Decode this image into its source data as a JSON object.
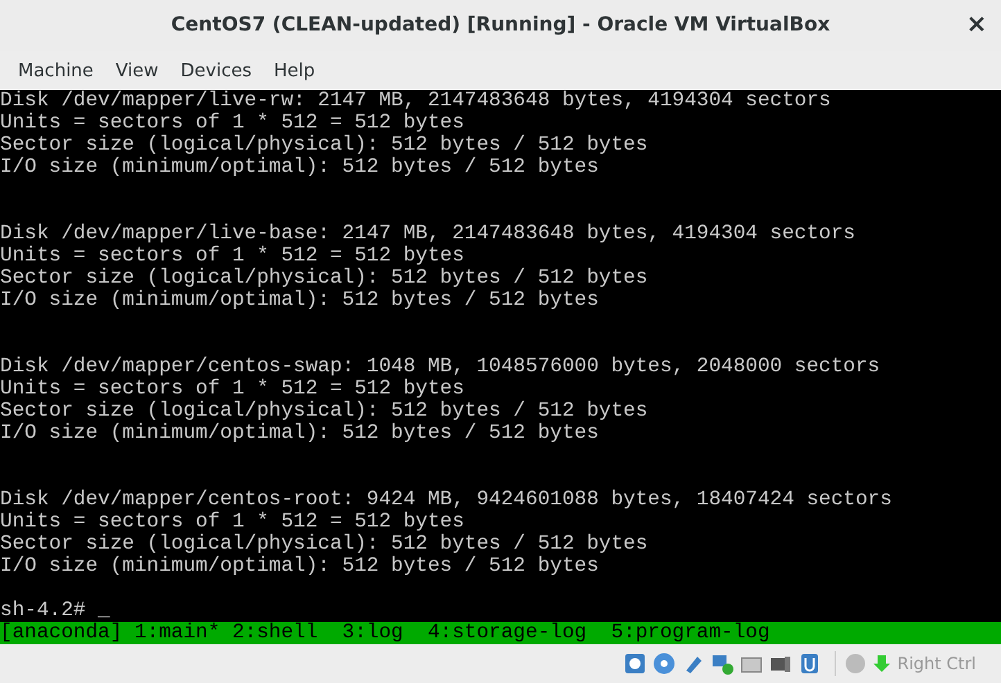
{
  "window": {
    "title": "CentOS7 (CLEAN-updated) [Running] - Oracle VM VirtualBox",
    "close": "×"
  },
  "menu": [
    "Machine",
    "View",
    "Devices",
    "Help"
  ],
  "terminal": {
    "blocks": [
      [
        "Disk /dev/mapper/live-rw: 2147 MB, 2147483648 bytes, 4194304 sectors",
        "Units = sectors of 1 * 512 = 512 bytes",
        "Sector size (logical/physical): 512 bytes / 512 bytes",
        "I/O size (minimum/optimal): 512 bytes / 512 bytes"
      ],
      [
        "Disk /dev/mapper/live-base: 2147 MB, 2147483648 bytes, 4194304 sectors",
        "Units = sectors of 1 * 512 = 512 bytes",
        "Sector size (logical/physical): 512 bytes / 512 bytes",
        "I/O size (minimum/optimal): 512 bytes / 512 bytes"
      ],
      [
        "Disk /dev/mapper/centos-swap: 1048 MB, 1048576000 bytes, 2048000 sectors",
        "Units = sectors of 1 * 512 = 512 bytes",
        "Sector size (logical/physical): 512 bytes / 512 bytes",
        "I/O size (minimum/optimal): 512 bytes / 512 bytes"
      ],
      [
        "Disk /dev/mapper/centos-root: 9424 MB, 9424601088 bytes, 18407424 sectors",
        "Units = sectors of 1 * 512 = 512 bytes",
        "Sector size (logical/physical): 512 bytes / 512 bytes",
        "I/O size (minimum/optimal): 512 bytes / 512 bytes"
      ]
    ],
    "prompt": "sh-4.2# _",
    "tmux_bar": "[anaconda] 1:main* 2:shell  3:log  4:storage-log  5:program-log"
  },
  "status_bar": {
    "host_key": "Right Ctrl"
  }
}
